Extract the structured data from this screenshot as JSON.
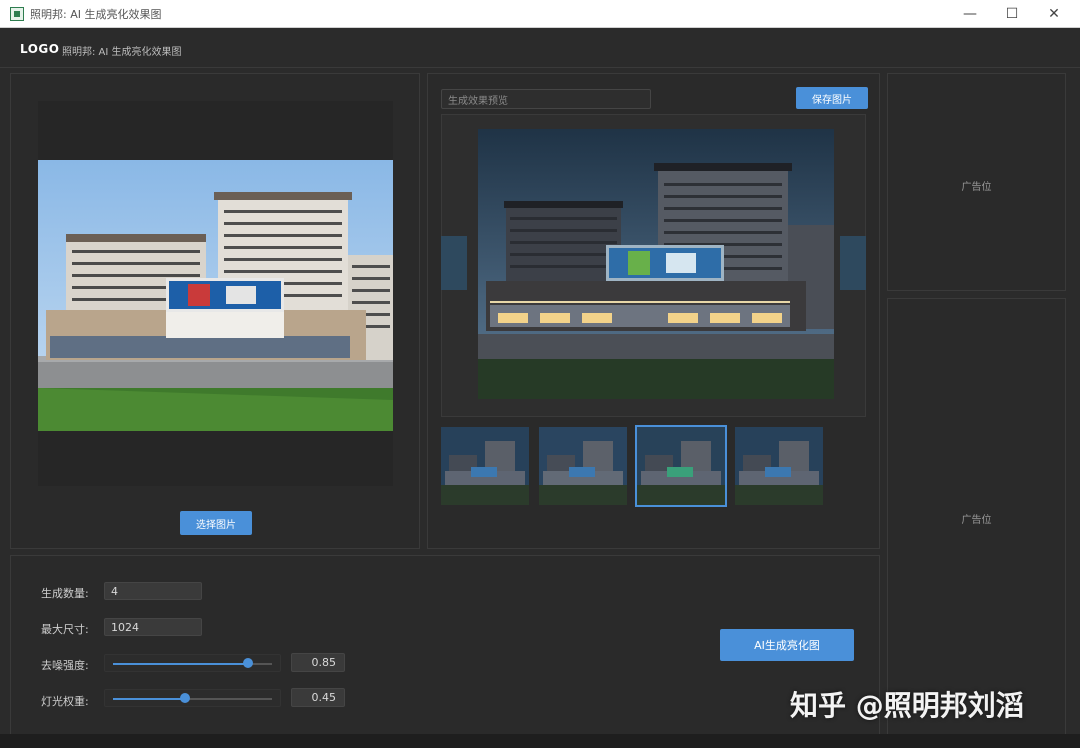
{
  "window": {
    "title": "照明邦: AI 生成亮化效果图",
    "minimize": "—",
    "maximize": "☐",
    "close": "✕"
  },
  "header": {
    "logo": "LOGO",
    "title": "照明邦: AI 生成亮化效果图"
  },
  "left_panel": {
    "select_button": "选择图片"
  },
  "preview_panel": {
    "tab_label": "生成效果预览",
    "save_button": "保存图片",
    "selected_thumbnail_index": 2,
    "thumbnail_count": 4
  },
  "ads": {
    "top": "广告位",
    "bottom": "广告位"
  },
  "settings": {
    "count_label": "生成数量:",
    "count_value": "4",
    "size_label": "最大尺寸:",
    "size_value": "1024",
    "denoise_label": "去噪强度:",
    "denoise_value": "0.85",
    "light_label": "灯光权重:",
    "light_value": "0.45",
    "generate_button": "AI生成亮化图"
  },
  "watermark": "知乎 @照明邦刘滔",
  "colors": {
    "accent": "#4a90d9",
    "background": "#2b2b2b",
    "panel_border": "#3a3a3a"
  }
}
